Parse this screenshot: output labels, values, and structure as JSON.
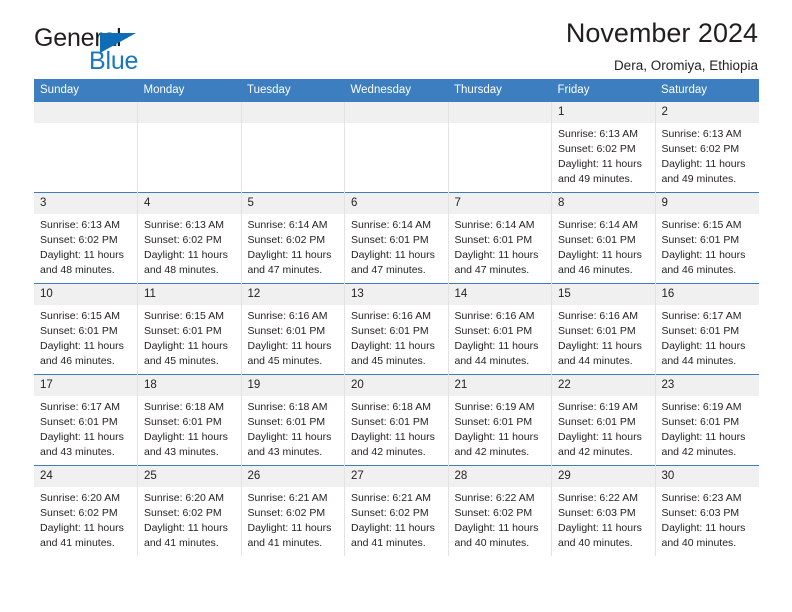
{
  "brand": {
    "word_general": "General",
    "word_blue": "Blue",
    "triangle_color": "#0f6cb6",
    "blue_color": "#1878be"
  },
  "header": {
    "title": "November 2024",
    "subtitle": "Dera, Oromiya, Ethiopia"
  },
  "theme": {
    "header_bar_color": "#3c7ebf",
    "day_band_color": "#f0f0f0",
    "text_color": "#231f20",
    "grid_line_color": "#e3e3e3"
  },
  "weekday_headers": [
    "Sunday",
    "Monday",
    "Tuesday",
    "Wednesday",
    "Thursday",
    "Friday",
    "Saturday"
  ],
  "labels": {
    "sunrise_prefix": "Sunrise:",
    "sunset_prefix": "Sunset:",
    "daylight_prefix": "Daylight:"
  },
  "weeks": [
    [
      {
        "day": "",
        "blank": true
      },
      {
        "day": "",
        "blank": true
      },
      {
        "day": "",
        "blank": true
      },
      {
        "day": "",
        "blank": true
      },
      {
        "day": "",
        "blank": true
      },
      {
        "day": "1",
        "sunrise": "Sunrise: 6:13 AM",
        "sunset": "Sunset: 6:02 PM",
        "daylight_line1": "Daylight: 11 hours",
        "daylight_line2": "and 49 minutes."
      },
      {
        "day": "2",
        "sunrise": "Sunrise: 6:13 AM",
        "sunset": "Sunset: 6:02 PM",
        "daylight_line1": "Daylight: 11 hours",
        "daylight_line2": "and 49 minutes."
      }
    ],
    [
      {
        "day": "3",
        "sunrise": "Sunrise: 6:13 AM",
        "sunset": "Sunset: 6:02 PM",
        "daylight_line1": "Daylight: 11 hours",
        "daylight_line2": "and 48 minutes."
      },
      {
        "day": "4",
        "sunrise": "Sunrise: 6:13 AM",
        "sunset": "Sunset: 6:02 PM",
        "daylight_line1": "Daylight: 11 hours",
        "daylight_line2": "and 48 minutes."
      },
      {
        "day": "5",
        "sunrise": "Sunrise: 6:14 AM",
        "sunset": "Sunset: 6:02 PM",
        "daylight_line1": "Daylight: 11 hours",
        "daylight_line2": "and 47 minutes."
      },
      {
        "day": "6",
        "sunrise": "Sunrise: 6:14 AM",
        "sunset": "Sunset: 6:01 PM",
        "daylight_line1": "Daylight: 11 hours",
        "daylight_line2": "and 47 minutes."
      },
      {
        "day": "7",
        "sunrise": "Sunrise: 6:14 AM",
        "sunset": "Sunset: 6:01 PM",
        "daylight_line1": "Daylight: 11 hours",
        "daylight_line2": "and 47 minutes."
      },
      {
        "day": "8",
        "sunrise": "Sunrise: 6:14 AM",
        "sunset": "Sunset: 6:01 PM",
        "daylight_line1": "Daylight: 11 hours",
        "daylight_line2": "and 46 minutes."
      },
      {
        "day": "9",
        "sunrise": "Sunrise: 6:15 AM",
        "sunset": "Sunset: 6:01 PM",
        "daylight_line1": "Daylight: 11 hours",
        "daylight_line2": "and 46 minutes."
      }
    ],
    [
      {
        "day": "10",
        "sunrise": "Sunrise: 6:15 AM",
        "sunset": "Sunset: 6:01 PM",
        "daylight_line1": "Daylight: 11 hours",
        "daylight_line2": "and 46 minutes."
      },
      {
        "day": "11",
        "sunrise": "Sunrise: 6:15 AM",
        "sunset": "Sunset: 6:01 PM",
        "daylight_line1": "Daylight: 11 hours",
        "daylight_line2": "and 45 minutes."
      },
      {
        "day": "12",
        "sunrise": "Sunrise: 6:16 AM",
        "sunset": "Sunset: 6:01 PM",
        "daylight_line1": "Daylight: 11 hours",
        "daylight_line2": "and 45 minutes."
      },
      {
        "day": "13",
        "sunrise": "Sunrise: 6:16 AM",
        "sunset": "Sunset: 6:01 PM",
        "daylight_line1": "Daylight: 11 hours",
        "daylight_line2": "and 45 minutes."
      },
      {
        "day": "14",
        "sunrise": "Sunrise: 6:16 AM",
        "sunset": "Sunset: 6:01 PM",
        "daylight_line1": "Daylight: 11 hours",
        "daylight_line2": "and 44 minutes."
      },
      {
        "day": "15",
        "sunrise": "Sunrise: 6:16 AM",
        "sunset": "Sunset: 6:01 PM",
        "daylight_line1": "Daylight: 11 hours",
        "daylight_line2": "and 44 minutes."
      },
      {
        "day": "16",
        "sunrise": "Sunrise: 6:17 AM",
        "sunset": "Sunset: 6:01 PM",
        "daylight_line1": "Daylight: 11 hours",
        "daylight_line2": "and 44 minutes."
      }
    ],
    [
      {
        "day": "17",
        "sunrise": "Sunrise: 6:17 AM",
        "sunset": "Sunset: 6:01 PM",
        "daylight_line1": "Daylight: 11 hours",
        "daylight_line2": "and 43 minutes."
      },
      {
        "day": "18",
        "sunrise": "Sunrise: 6:18 AM",
        "sunset": "Sunset: 6:01 PM",
        "daylight_line1": "Daylight: 11 hours",
        "daylight_line2": "and 43 minutes."
      },
      {
        "day": "19",
        "sunrise": "Sunrise: 6:18 AM",
        "sunset": "Sunset: 6:01 PM",
        "daylight_line1": "Daylight: 11 hours",
        "daylight_line2": "and 43 minutes."
      },
      {
        "day": "20",
        "sunrise": "Sunrise: 6:18 AM",
        "sunset": "Sunset: 6:01 PM",
        "daylight_line1": "Daylight: 11 hours",
        "daylight_line2": "and 42 minutes."
      },
      {
        "day": "21",
        "sunrise": "Sunrise: 6:19 AM",
        "sunset": "Sunset: 6:01 PM",
        "daylight_line1": "Daylight: 11 hours",
        "daylight_line2": "and 42 minutes."
      },
      {
        "day": "22",
        "sunrise": "Sunrise: 6:19 AM",
        "sunset": "Sunset: 6:01 PM",
        "daylight_line1": "Daylight: 11 hours",
        "daylight_line2": "and 42 minutes."
      },
      {
        "day": "23",
        "sunrise": "Sunrise: 6:19 AM",
        "sunset": "Sunset: 6:01 PM",
        "daylight_line1": "Daylight: 11 hours",
        "daylight_line2": "and 42 minutes."
      }
    ],
    [
      {
        "day": "24",
        "sunrise": "Sunrise: 6:20 AM",
        "sunset": "Sunset: 6:02 PM",
        "daylight_line1": "Daylight: 11 hours",
        "daylight_line2": "and 41 minutes."
      },
      {
        "day": "25",
        "sunrise": "Sunrise: 6:20 AM",
        "sunset": "Sunset: 6:02 PM",
        "daylight_line1": "Daylight: 11 hours",
        "daylight_line2": "and 41 minutes."
      },
      {
        "day": "26",
        "sunrise": "Sunrise: 6:21 AM",
        "sunset": "Sunset: 6:02 PM",
        "daylight_line1": "Daylight: 11 hours",
        "daylight_line2": "and 41 minutes."
      },
      {
        "day": "27",
        "sunrise": "Sunrise: 6:21 AM",
        "sunset": "Sunset: 6:02 PM",
        "daylight_line1": "Daylight: 11 hours",
        "daylight_line2": "and 41 minutes."
      },
      {
        "day": "28",
        "sunrise": "Sunrise: 6:22 AM",
        "sunset": "Sunset: 6:02 PM",
        "daylight_line1": "Daylight: 11 hours",
        "daylight_line2": "and 40 minutes."
      },
      {
        "day": "29",
        "sunrise": "Sunrise: 6:22 AM",
        "sunset": "Sunset: 6:03 PM",
        "daylight_line1": "Daylight: 11 hours",
        "daylight_line2": "and 40 minutes."
      },
      {
        "day": "30",
        "sunrise": "Sunrise: 6:23 AM",
        "sunset": "Sunset: 6:03 PM",
        "daylight_line1": "Daylight: 11 hours",
        "daylight_line2": "and 40 minutes."
      }
    ]
  ]
}
